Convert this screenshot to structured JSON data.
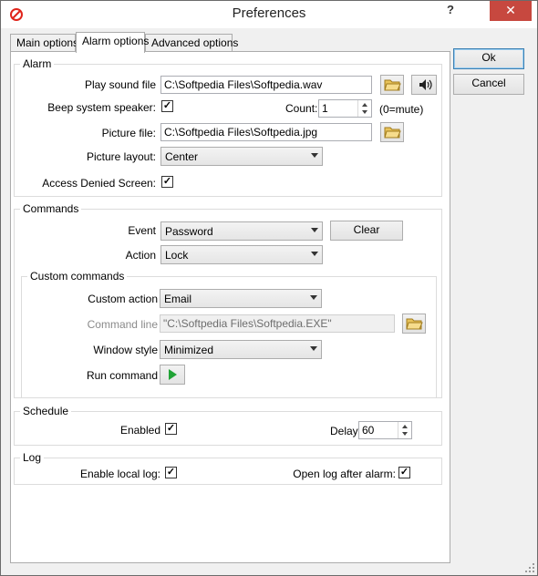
{
  "window": {
    "title": "Preferences",
    "help": "?",
    "close": "✕"
  },
  "tabs": [
    {
      "label": "Main options",
      "active": false
    },
    {
      "label": "Alarm options",
      "active": true
    },
    {
      "label": "Advanced options",
      "active": false
    }
  ],
  "alarm": {
    "group_label": "Alarm",
    "play_sound_label": "Play sound file",
    "play_sound_value": "C:\\Softpedia Files\\Softpedia.wav",
    "beep_label": "Beep system speaker:",
    "beep_checked": true,
    "count_label": "Count:",
    "count_value": "1",
    "count_hint": "(0=mute)",
    "picture_file_label": "Picture file:",
    "picture_file_value": "C:\\Softpedia Files\\Softpedia.jpg",
    "picture_layout_label": "Picture layout:",
    "picture_layout_value": "Center",
    "access_denied_label": "Access Denied Screen:",
    "access_denied_checked": true
  },
  "commands": {
    "group_label": "Commands",
    "event_label": "Event",
    "event_value": "Password",
    "clear_label": "Clear",
    "action_label": "Action",
    "action_value": "Lock",
    "custom": {
      "group_label": "Custom commands",
      "custom_action_label": "Custom action",
      "custom_action_value": "Email",
      "command_line_label": "Command line",
      "command_line_value": "\"C:\\Softpedia Files\\Softpedia.EXE\"",
      "window_style_label": "Window style",
      "window_style_value": "Minimized",
      "run_command_label": "Run command"
    }
  },
  "schedule": {
    "group_label": "Schedule",
    "enabled_label": "Enabled",
    "enabled_checked": true,
    "delay_label": "Delay",
    "delay_value": "60"
  },
  "log": {
    "group_label": "Log",
    "enable_local_label": "Enable local log:",
    "enable_local_checked": true,
    "open_after_label": "Open log after alarm:",
    "open_after_checked": true
  },
  "buttons": {
    "ok": "Ok",
    "cancel": "Cancel"
  },
  "check_glyph": "✓",
  "colors": {
    "close_bg": "#c7483f",
    "play_green": "#21a336",
    "folder_yellow": "#e8c35a"
  }
}
